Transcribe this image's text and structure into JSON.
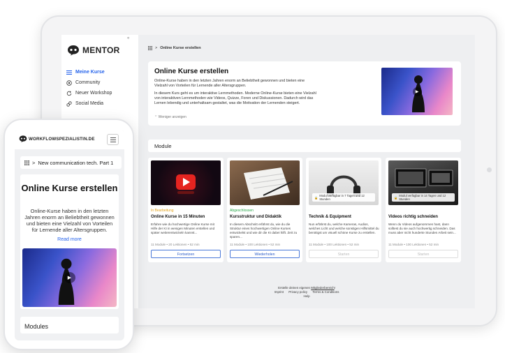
{
  "tablet": {
    "logo_text": "MENTOR",
    "collapse_icon": "«",
    "nav": [
      {
        "label": "Meine Kurse",
        "icon": "grid-icon",
        "active": true
      },
      {
        "label": "Community",
        "icon": "target-icon",
        "active": false
      },
      {
        "label": "Neuer Workshop",
        "icon": "refresh-icon",
        "active": false
      },
      {
        "label": "Social Media",
        "icon": "link-icon",
        "active": false
      }
    ],
    "breadcrumb": {
      "separator": ">",
      "current": "Online Kurse erstellen"
    },
    "hero": {
      "title": "Online Kurse erstellen",
      "paragraph1": "Online-Kurse haben in den letzten Jahren enorm an Beliebtheit gewonnen und bieten eine Vielzahl von Vorteilen für Lernende aller Altersgruppen.",
      "paragraph2": "In diesem Kurs geht es um interaktive Lernmethoden. Moderne Online-Kurse bieten eine Vielzahl von interaktiven Lernmethoden wie Videos, Quizze, Foren und Diskussionen. Dadurch wird das Lernen lebendig und unterhaltsam gestaltet, was die Motivation der Lernenden steigert.",
      "show_less": "Weniger anzeigen"
    },
    "modules_title": "Module",
    "cards": [
      {
        "status": "In Bearbeitung",
        "status_color": "#e3a21a",
        "title": "Online Kurse in 15 Minuten",
        "desc": "Erfahre wie du hochwertige Online Kurse mit Hilfe der KI in wenigen Minuten erstellen und später weiterentwickeln kannst...",
        "meta": "11 Module • 20 Lektionen • 52 min",
        "button": "Fortsetzen",
        "locked": false,
        "lock_text": ""
      },
      {
        "status": "Abgeschlossen",
        "status_color": "#2aa84a",
        "title": "Kursstruktur und Didaktik",
        "desc": "In diesem Abschnitt erfährst du, wie du die Struktur eines hochwertigen Online Kurses entwickelst und wie dir die KI dabei hilft. Zeit zu sparen...",
        "meta": "11 Module • 100 Lektionen • 52 min",
        "button": "Wiederholen",
        "locked": false,
        "lock_text": ""
      },
      {
        "status": "",
        "status_color": "#888888",
        "title": "Technik & Equipment",
        "desc": "Nun erfährst du, welche Kameras, Audios, welches Licht und welche sonstigen Hilfsmittel du benötigst um visuell schöne Kurse zu erstellen.",
        "meta": "11 Module • 100 Lektionen • 52 min",
        "button": "Starten",
        "locked": true,
        "lock_text": "Modul verfügbar in 7 Tagen und 12 Stunden"
      },
      {
        "status": "",
        "status_color": "#888888",
        "title": "Videos richtig schneiden",
        "desc": "Wenn du Videos aufgenommen hast, dann solltest du sie auch hochwertig schneiden. Das muss aber nicht hunderte Stunden Arbeit sein...",
        "meta": "11 Module • 100 Lektionen • 52 min",
        "button": "Starten",
        "locked": true,
        "lock_text": "Modul verfügbar in 14 Tagen und 12 Stunden"
      }
    ],
    "footer": {
      "line1_prefix": "Erstelle deinen eigenen ",
      "line1_link": "Mitgliederbereich",
      "line1_suffix": "!",
      "links": [
        "Imprint",
        "Privacy policy",
        "Terms & Conditions"
      ],
      "help": "Help"
    }
  },
  "phone": {
    "logo_text": "WORKFLOWSPEZIALISTIN.DE",
    "breadcrumb": "New communication tech. Part 1",
    "title": "Online Kurse erstellen",
    "desc": "Online-Kurse haben in den letzten Jahren enorm an Beliebtheit gewonnen und bieten eine Vielzahl von Vorteilen für Lernende aller Altersgruppen.",
    "read_more": "Read more",
    "modules_title": "Modules"
  },
  "colors": {
    "accent": "#2563eb",
    "background": "#eeeff1"
  }
}
